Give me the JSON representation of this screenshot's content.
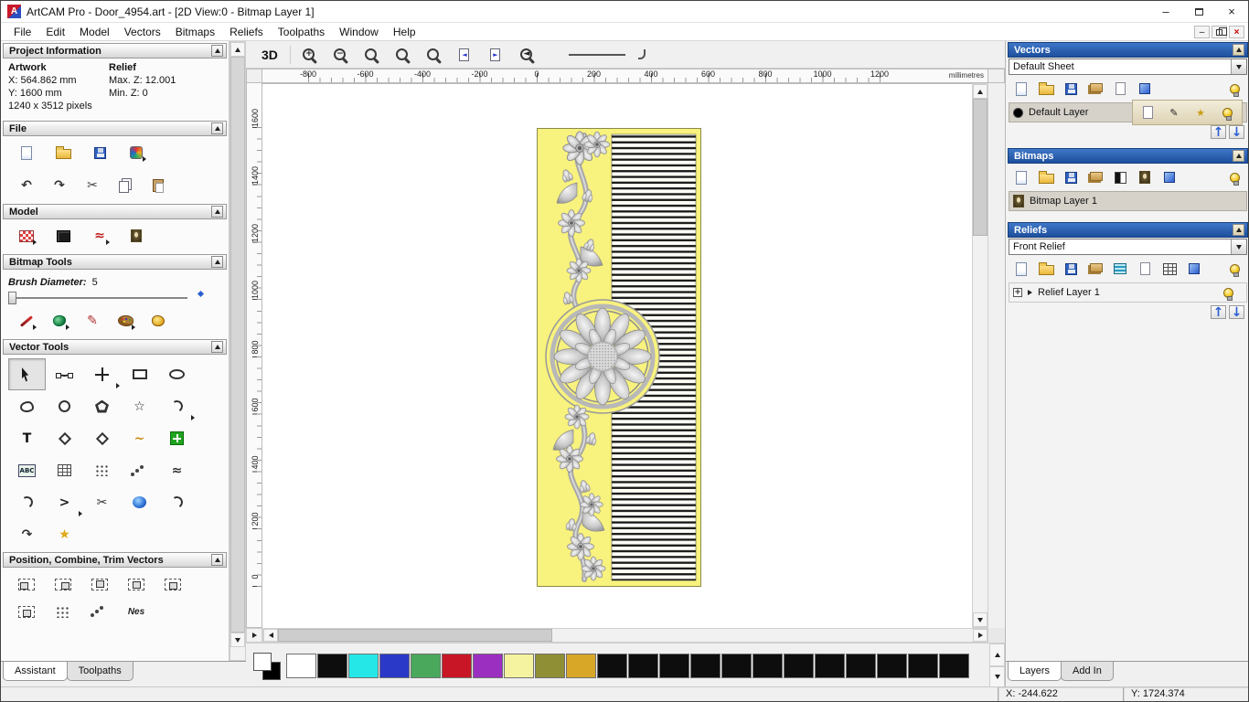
{
  "window": {
    "app_icon_letter": "A",
    "title": "ArtCAM Pro - Door_4954.art - [2D View:0 - Bitmap Layer 1]",
    "minimize_glyph": "–",
    "close_glyph": "×"
  },
  "menubar": {
    "items": [
      "File",
      "Edit",
      "Model",
      "Vectors",
      "Bitmaps",
      "Reliefs",
      "Toolpaths",
      "Window",
      "Help"
    ],
    "child_minimize_glyph": "–",
    "child_close_glyph": "×"
  },
  "assistant": {
    "project_information": {
      "title": "Project Information",
      "artwork_heading": "Artwork",
      "relief_heading": "Relief",
      "artwork_x": "X: 564.862 mm",
      "artwork_y": "Y: 1600 mm",
      "artwork_pixels": "1240 x 3512 pixels",
      "relief_max_z": "Max. Z: 12.001",
      "relief_min_z": "Min. Z: 0"
    },
    "file": {
      "title": "File",
      "tools_row1": [
        {
          "name": "new-model",
          "icon": "page"
        },
        {
          "name": "open-model",
          "icon": "folder"
        },
        {
          "name": "save-model",
          "icon": "floppy"
        },
        {
          "name": "import-3d-model",
          "icon": "import",
          "flyout": true
        }
      ],
      "tools_row2": [
        {
          "name": "undo",
          "glyph": "↶",
          "color": "#333"
        },
        {
          "name": "redo",
          "glyph": "↷",
          "color": "#333"
        },
        {
          "name": "cut",
          "glyph": "✂",
          "color": "#444"
        },
        {
          "name": "copy",
          "icon": "copy"
        },
        {
          "name": "paste",
          "icon": "paste"
        }
      ]
    },
    "model": {
      "title": "Model",
      "tools": [
        {
          "name": "set-model-size",
          "icon": "redgrid",
          "flyout": true
        },
        {
          "name": "adjust-model-size",
          "icon": "darkbox"
        },
        {
          "name": "model-notes",
          "glyph": "≈",
          "color": "#c02020",
          "flyout": true
        },
        {
          "name": "load-reference-bitmap",
          "icon": "portrait"
        }
      ]
    },
    "bitmap_tools": {
      "title": "Bitmap Tools",
      "brush_diameter_label": "Brush Diameter:",
      "brush_diameter_value": "5",
      "tools": [
        {
          "name": "draw-tool",
          "icon": "brush",
          "flyout": true
        },
        {
          "name": "flood-fill",
          "icon": "blob2",
          "flyout": true
        },
        {
          "name": "pick-colour",
          "glyph": "✎",
          "color": "#b03030"
        },
        {
          "name": "colour-palette",
          "icon": "palette",
          "flyout": true
        },
        {
          "name": "eraser",
          "icon": "yellowblob"
        }
      ]
    },
    "vector_tools": {
      "title": "Vector Tools",
      "tools": [
        {
          "name": "select-vectors",
          "icon": "cursor",
          "active": true
        },
        {
          "name": "node-editing",
          "icon": "nodes"
        },
        {
          "name": "transform-vectors",
          "icon": "move",
          "flyout": true
        },
        {
          "name": "create-rectangle",
          "icon": "rect"
        },
        {
          "name": "create-ellipse",
          "icon": "ellipse"
        },
        {
          "name": "create-freehand-shape",
          "icon": "blob"
        },
        {
          "name": "create-circle",
          "icon": "circle"
        },
        {
          "name": "create-polygon",
          "icon": "pentagon"
        },
        {
          "name": "create-star",
          "glyph": "☆",
          "color": "#222"
        },
        {
          "name": "create-arc",
          "icon": "arc",
          "flyout": true
        },
        {
          "name": "create-text",
          "glyph": "T",
          "color": "#111"
        },
        {
          "name": "measure-tool",
          "icon": "diamond"
        },
        {
          "name": "offset-vector",
          "icon": "diamond"
        },
        {
          "name": "paste-along-curve",
          "glyph": "~",
          "color": "#c89018"
        },
        {
          "name": "bitmap-to-vector",
          "icon": "greenplus"
        },
        {
          "name": "paragraph-text",
          "glyph": "ABC",
          "icon": "abc"
        },
        {
          "name": "envelope-distort",
          "icon": "grid"
        },
        {
          "name": "block-copy",
          "icon": "dots"
        },
        {
          "name": "paste-array-along-curve",
          "icon": "dot3"
        },
        {
          "name": "fit-arcs-to-curve",
          "glyph": "≈",
          "color": "#333"
        },
        {
          "name": "create-arc-through-points",
          "icon": "arc"
        },
        {
          "name": "join-vectors",
          "glyph": ">",
          "color": "#222",
          "flyout": true
        },
        {
          "name": "trim-vectors",
          "glyph": "✂",
          "color": "#333"
        },
        {
          "name": "interactive-distortion",
          "icon": "bluedisc"
        },
        {
          "name": "fillet-corners",
          "icon": "arc"
        },
        {
          "name": "fit-curve-to-points",
          "glyph": "↷",
          "color": "#333"
        },
        {
          "name": "vector-doctor",
          "glyph": "★",
          "color": "#e0a818"
        }
      ]
    },
    "position_combine_trim": {
      "title": "Position, Combine, Trim Vectors",
      "tools_row1": [
        {
          "name": "align-left",
          "icon": "align-l"
        },
        {
          "name": "align-right",
          "icon": "align-r"
        },
        {
          "name": "align-top",
          "icon": "align-t"
        },
        {
          "name": "align-bottom",
          "icon": "align-b"
        },
        {
          "name": "align-centre",
          "icon": "align-c"
        }
      ],
      "tools_row2": [
        {
          "name": "centre-in-page",
          "icon": "align-c"
        },
        {
          "name": "paste-in-position",
          "icon": "dots"
        },
        {
          "name": "scatter-copies",
          "icon": "dot3"
        },
        {
          "name": "nest-vectors",
          "glyph": "Nes",
          "icon": "nes"
        }
      ]
    },
    "tabs": [
      "Assistant",
      "Toolpaths"
    ],
    "active_tab": "Assistant"
  },
  "view": {
    "toolbar": {
      "view_3d": "3D",
      "zoom_tools": [
        {
          "name": "zoom-in",
          "icon": "mag",
          "glyph": "+"
        },
        {
          "name": "zoom-out",
          "icon": "mag",
          "glyph": "−"
        },
        {
          "name": "zoom-to-box",
          "icon": "mag"
        },
        {
          "name": "zoom-to-fit",
          "icon": "mag"
        },
        {
          "name": "zoom-to-objects",
          "icon": "mag"
        },
        {
          "name": "previous-sheet",
          "icon": "pagenav",
          "glyph": "◄"
        },
        {
          "name": "next-sheet",
          "icon": "pagenav",
          "glyph": "►"
        },
        {
          "name": "zoom-previous",
          "icon": "mag",
          "glyph": "◄"
        }
      ]
    },
    "ruler_horizontal": {
      "ticks": [
        "-800",
        "-600",
        "-400",
        "-200",
        "0",
        "200",
        "400",
        "600",
        "800",
        "1000",
        "1200"
      ],
      "unit": "millimetres"
    },
    "ruler_vertical": {
      "ticks": [
        "1600",
        "1400",
        "1200",
        "1000",
        "800",
        "600",
        "400",
        "200",
        "0"
      ]
    }
  },
  "palette": {
    "colors": [
      "#ffffff",
      "#0d0d0d",
      "#26e7e7",
      "#2b39c8",
      "#4aa85c",
      "#c81626",
      "#9b2fc0",
      "#f6f3a0",
      "#8f8f35",
      "#d8a727",
      "#0d0d0d",
      "#0d0d0d",
      "#0d0d0d",
      "#0d0d0d",
      "#0d0d0d",
      "#0d0d0d",
      "#0d0d0d",
      "#0d0d0d",
      "#0d0d0d",
      "#0d0d0d",
      "#0d0d0d",
      "#0d0d0d"
    ]
  },
  "layers_panel": {
    "vectors": {
      "title": "Vectors",
      "sheet_dropdown_value": "Default Sheet",
      "toolbar": [
        {
          "name": "new-vector-layer",
          "icon": "page"
        },
        {
          "name": "open-vector-layer",
          "icon": "folder"
        },
        {
          "name": "save-vector-layer",
          "icon": "floppy"
        },
        {
          "name": "import-vectors",
          "icon": "stack"
        },
        {
          "name": "new-sheet",
          "icon": "page2"
        },
        {
          "name": "delete-vector-layer",
          "icon": "bluecube"
        },
        {
          "name": "toggle-all-vectors-visibility",
          "icon": "bulb"
        }
      ],
      "layer": {
        "name": "Default Layer",
        "color": "#000000"
      },
      "row_tools": [
        {
          "name": "select-all-on-layer",
          "icon": "page2"
        },
        {
          "name": "edit-layer-name",
          "glyph": "✎",
          "color": "#222"
        },
        {
          "name": "layer-colour",
          "glyph": "★",
          "color": "#caa016"
        },
        {
          "name": "layer-visibility",
          "icon": "bulb"
        }
      ],
      "updown": [
        {
          "name": "move-vector-layer-up",
          "glyph": "↑",
          "color": "#2b5fd0"
        },
        {
          "name": "move-vector-layer-down",
          "glyph": "↓",
          "color": "#2b5fd0"
        }
      ]
    },
    "bitmaps": {
      "title": "Bitmaps",
      "toolbar": [
        {
          "name": "new-bitmap-layer",
          "icon": "page"
        },
        {
          "name": "open-bitmap-layer",
          "icon": "folder"
        },
        {
          "name": "save-bitmap-layer",
          "icon": "floppy"
        },
        {
          "name": "import-bitmap",
          "icon": "stack"
        },
        {
          "name": "bitmap-contrast",
          "icon": "half"
        },
        {
          "name": "greyscale-preview",
          "icon": "portrait"
        },
        {
          "name": "delete-bitmap-layer",
          "icon": "bluecube"
        },
        {
          "name": "toggle-all-bitmaps-visibility",
          "icon": "bulb"
        }
      ],
      "layer": {
        "name": "Bitmap Layer 1"
      }
    },
    "reliefs": {
      "title": "Reliefs",
      "relief_dropdown_value": "Front Relief",
      "toolbar": [
        {
          "name": "new-relief-layer",
          "icon": "page"
        },
        {
          "name": "open-relief-layer",
          "icon": "folder"
        },
        {
          "name": "save-relief-layer",
          "icon": "floppy"
        },
        {
          "name": "import-relief",
          "icon": "stack"
        },
        {
          "name": "smooth-relief",
          "icon": "bluewave"
        },
        {
          "name": "relief-sheet",
          "icon": "page2"
        },
        {
          "name": "calculate-relief",
          "icon": "grid"
        },
        {
          "name": "delete-relief-layer",
          "icon": "bluecube"
        },
        {
          "name": "toggle-all-reliefs-visibility",
          "icon": "bulb"
        }
      ],
      "layer": {
        "name": "Relief Layer 1",
        "expand_glyph": "+"
      },
      "row_tools": [
        {
          "name": "relief-layer-visibility",
          "icon": "bulb"
        }
      ],
      "updown": [
        {
          "name": "move-relief-layer-up",
          "glyph": "↑",
          "color": "#2b5fd0"
        },
        {
          "name": "move-relief-layer-down",
          "glyph": "↓",
          "color": "#2b5fd0"
        }
      ]
    },
    "tabs": [
      "Layers",
      "Add In"
    ],
    "active_tab": "Layers"
  },
  "statusbar": {
    "x": "X: -244.622",
    "y": "Y: 1724.374"
  }
}
